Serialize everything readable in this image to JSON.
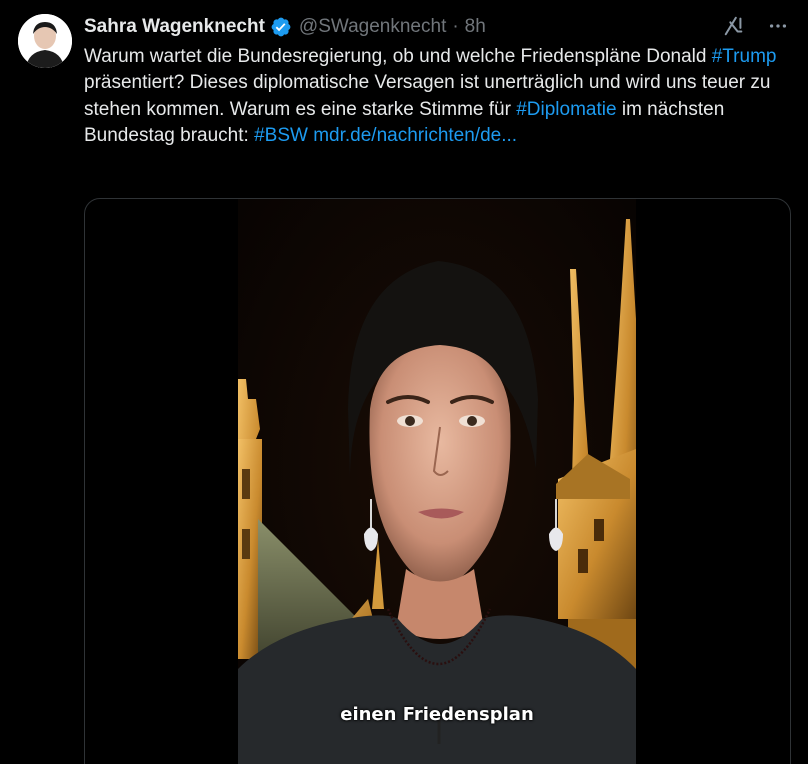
{
  "author": {
    "display_name": "Sahra Wagenknecht",
    "handle": "@SWagenknecht",
    "separator": "·",
    "time": "8h",
    "avatar_icon": "profile-photo",
    "verified_icon": "verified-badge-icon"
  },
  "tweet": {
    "text_1": "Warum wartet die Bundesregierung, ob und welche Friedenspläne Donald ",
    "hashtag_trump": "#Trump",
    "text_2": " präsentiert? Dieses diplomatische Versagen ist unerträglich und wird uns teuer zu stehen kommen. Warum es eine starke Stimme für ",
    "hashtag_diplomatie": "#Diplomatie",
    "text_3": " im nächsten Bundestag braucht: ",
    "hashtag_bsw": "#BSW",
    "text_4": " ",
    "link": "mdr.de/nachrichten/de..."
  },
  "video": {
    "caption": "einen Friedensplan"
  },
  "actions": {
    "grok_icon": "grok-icon",
    "more_icon": "more-icon"
  },
  "colors": {
    "background": "#000000",
    "text": "#e7e9ea",
    "secondary_text": "#71767b",
    "link": "#1d9bf0",
    "verified": "#1d9bf0",
    "border": "#2f3336"
  }
}
